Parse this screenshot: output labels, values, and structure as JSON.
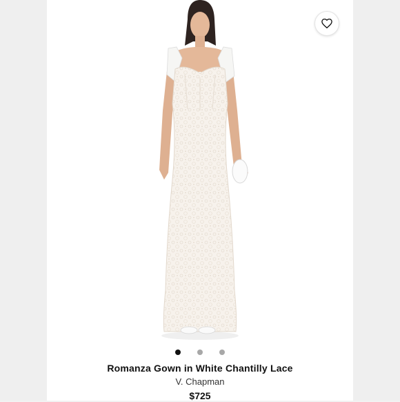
{
  "product": {
    "title": "Romanza Gown in White Chantilly Lace",
    "brand": "V. Chapman",
    "price": "$725",
    "image_alt": "model-wearing-white-lace-gown"
  },
  "carousel": {
    "dot_count": 3,
    "active_index": 0
  },
  "icons": {
    "favorite": "heart-outline-icon"
  },
  "colors": {
    "background": "#ffffff",
    "dot_active": "#111111",
    "dot_inactive": "#a8a8a8",
    "text": "#111111"
  }
}
